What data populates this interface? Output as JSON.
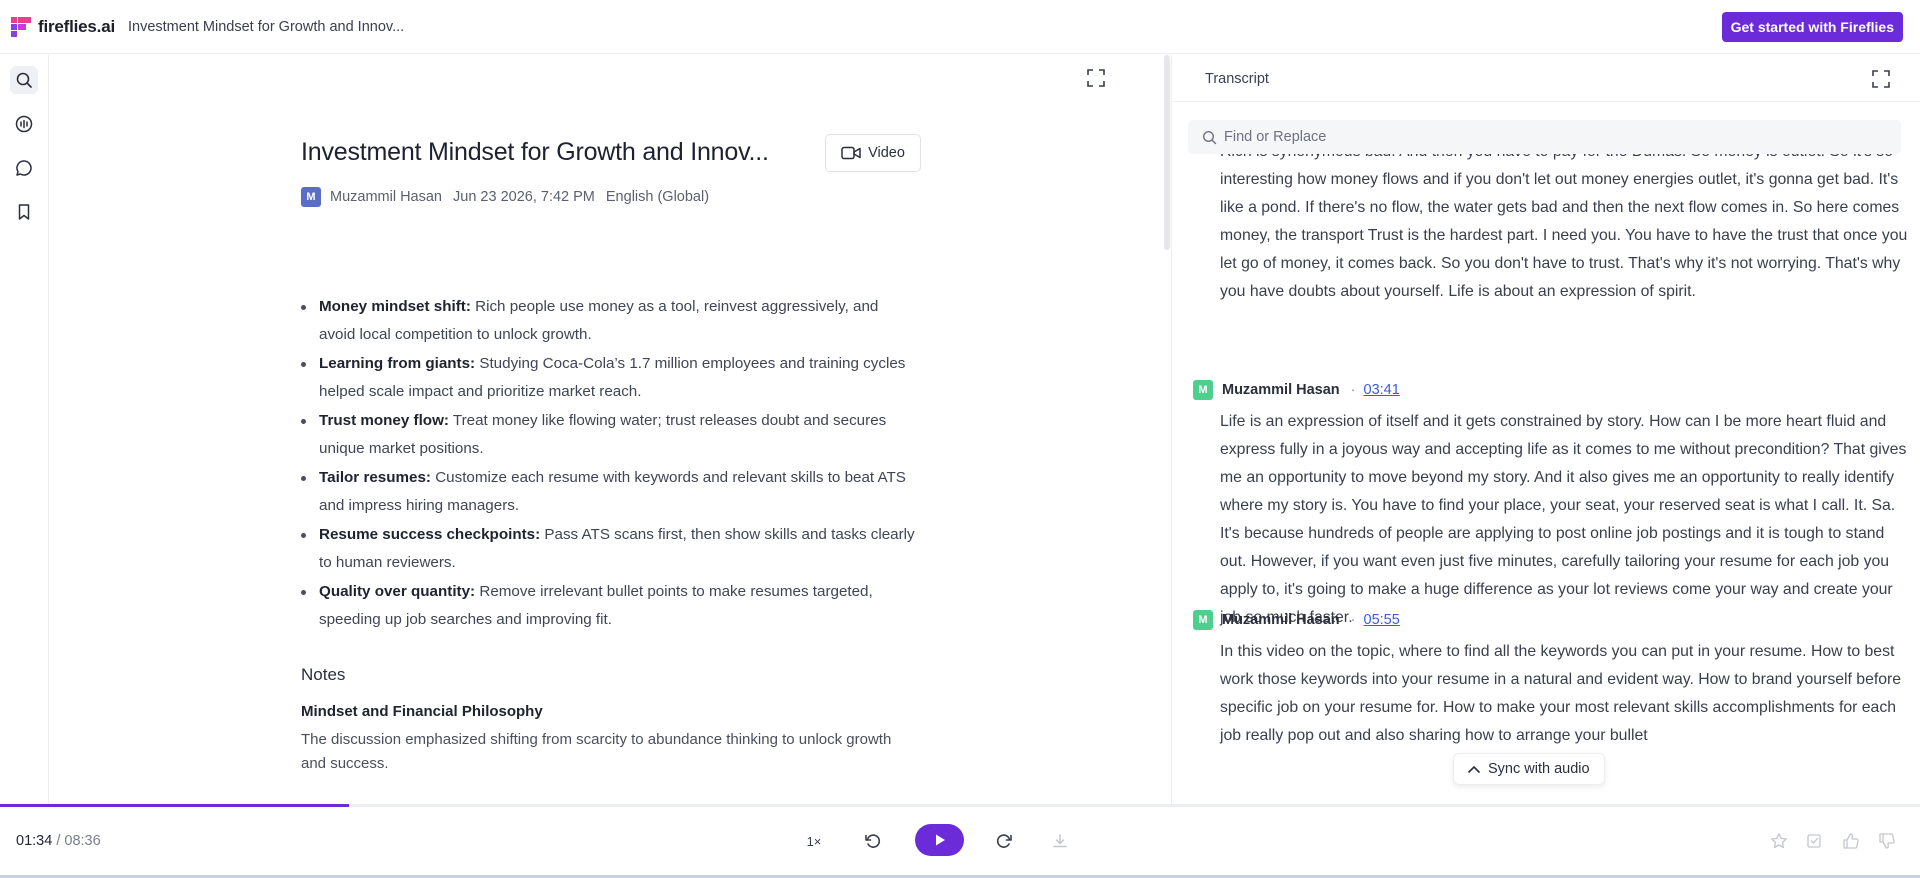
{
  "app": {
    "brand": "fireflies.ai",
    "meeting_title_short": "Investment Mindset for Growth and Innov...",
    "cta_label": "Get started with Fireflies"
  },
  "rail": {
    "icons": [
      "search-icon",
      "soundbite-icon",
      "chat-icon",
      "bookmark-icon"
    ]
  },
  "summary": {
    "title": "Investment Mindset for Growth and Innov...",
    "video_label": "Video",
    "avatar_initial": "M",
    "organizer": "Muzammil Hasan",
    "date": "Jun 23 2026, 7:42 PM",
    "language": "English (Global)",
    "bullets": [
      {
        "label": "Money mindset shift:",
        "text": " Rich people use money as a tool, reinvest aggressively, and avoid local competition to unlock growth."
      },
      {
        "label": "Learning from giants:",
        "text": " Studying Coca-Cola’s 1.7 million employees and training cycles helped scale impact and prioritize market reach."
      },
      {
        "label": "Trust money flow:",
        "text": " Treat money like flowing water; trust releases doubt and secures unique market positions."
      },
      {
        "label": "Tailor resumes:",
        "text": " Customize each resume with keywords and relevant skills to beat ATS and impress hiring managers."
      },
      {
        "label": "Resume success checkpoints:",
        "text": " Pass ATS scans first, then show skills and tasks clearly to human reviewers."
      },
      {
        "label": "Quality over quantity:",
        "text": " Remove irrelevant bullet points to make resumes targeted, speeding up job searches and improving fit."
      }
    ],
    "notes_heading": "Notes",
    "notes_subheading": "Mindset and Financial Philosophy",
    "notes_text": "The discussion emphasized shifting from scarcity to abundance thinking to unlock growth and success."
  },
  "transcript": {
    "tab_label": "Transcript",
    "search_placeholder": "Find or Replace",
    "first_block": "Rich is synonymous bad. And then you have to pay for the Dumas. So money is outlet. So it's so interesting how money flows and if you don't let out money energies outlet, it's gonna get bad. It's like a pond. If there's no flow, the water gets bad and then the next flow comes in. So here comes money, the transport Trust is the hardest part. I need you. You have to have the trust that once you let go of money, it comes back. So you don't have to trust. That's why it's not worrying. That's why you have doubts about yourself. Life is about an expression of spirit.",
    "entries": [
      {
        "speaker": "Muzammil Hasan",
        "initial": "M",
        "time": "03:41",
        "text": "Life is an expression of itself and it gets constrained by story. How can I be more heart fluid and express fully in a joyous way and accepting life as it comes to me without precondition? That gives me an opportunity to move beyond my story. And it also gives me an opportunity to really identify where my story is. You have to find your place, your seat, your reserved seat is what I call. It. Sa. It's because hundreds of people are applying to post online job postings and it is tough to stand out. However, if you want even just five minutes, carefully tailoring your resume for each job you apply to, it's going to make a huge difference as your lot reviews come your way and create your job so much faster."
      },
      {
        "speaker": "Muzammil Hasan",
        "initial": "M",
        "time": "05:55",
        "text": "In this video on the topic, where to find all the keywords you can put in your resume. How to best work those keywords into your resume in a natural and evident way. How to brand yourself before specific job on your resume for. How to make your most relevant skills accomplishments for each job really pop out and also sharing how to arrange your bullet"
      }
    ],
    "sync_label": "Sync with audio"
  },
  "player": {
    "current_time": "01:34",
    "separator": " / ",
    "duration": "08:36",
    "progress_fraction": 0.182,
    "speed_label": "1×",
    "accent": "#6c2bd9"
  }
}
